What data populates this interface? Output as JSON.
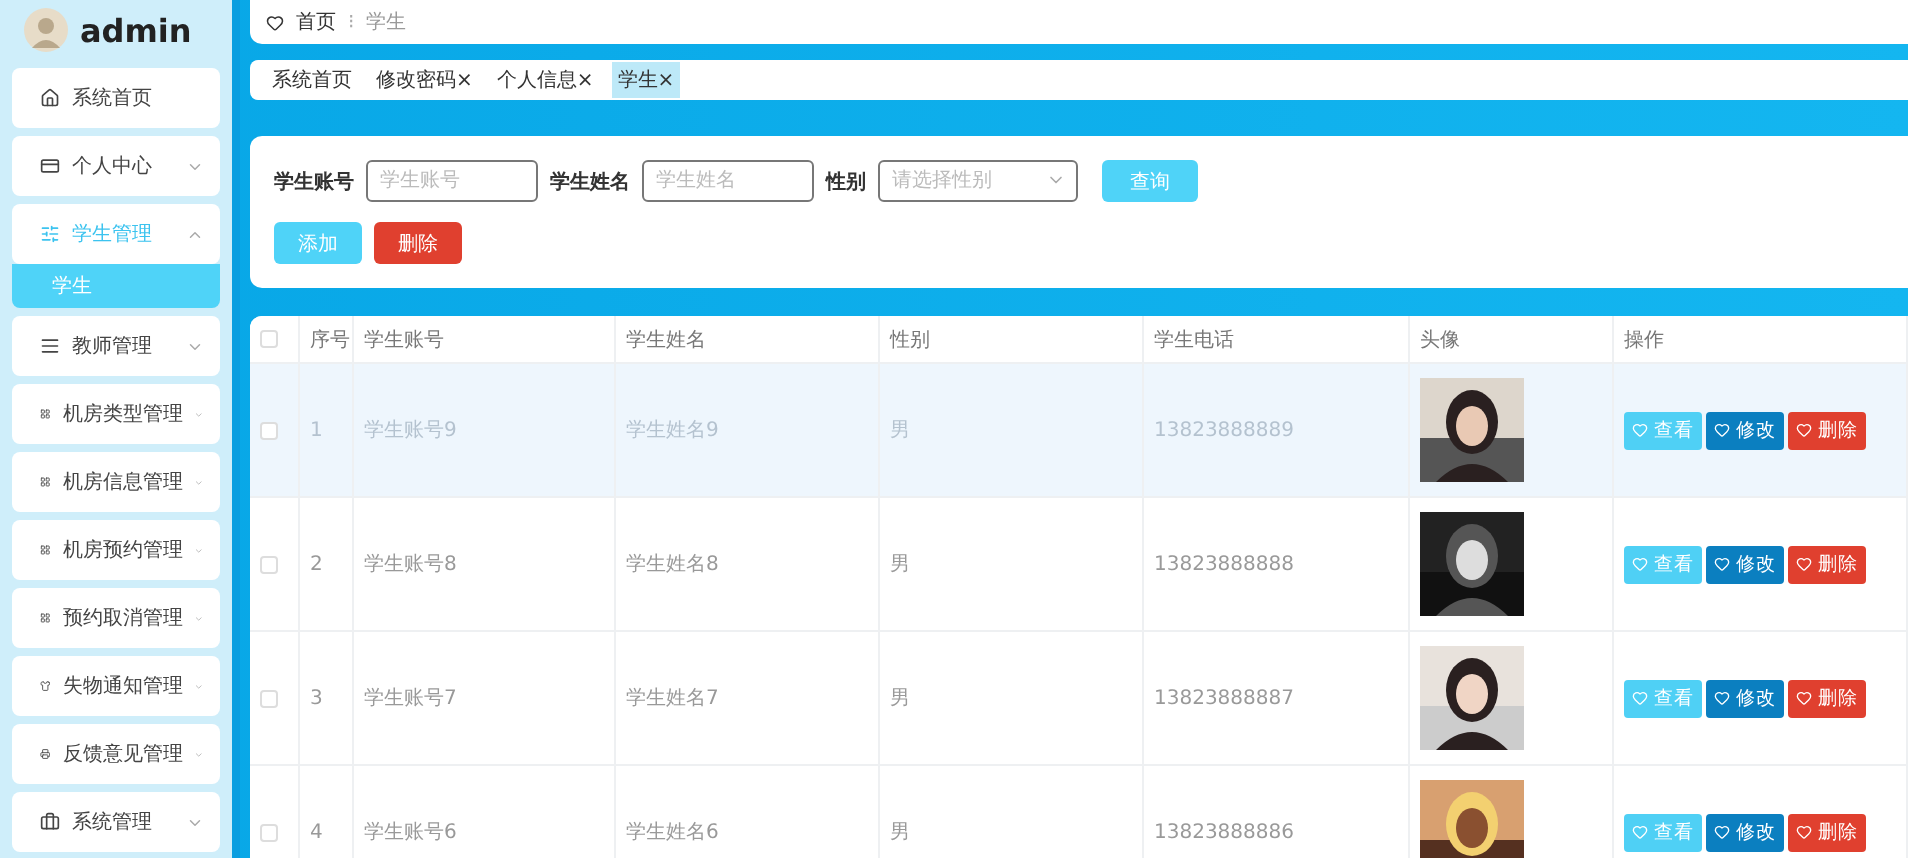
{
  "sidebar": {
    "user": "admin",
    "items": [
      {
        "label": "系统首页",
        "kind": "link"
      },
      {
        "label": "个人中心",
        "kind": "menu",
        "expanded": false
      },
      {
        "label": "学生管理",
        "kind": "menu",
        "expanded": true,
        "children": [
          {
            "label": "学生",
            "selected": true
          }
        ]
      },
      {
        "label": "教师管理",
        "kind": "menu",
        "expanded": false
      },
      {
        "label": "机房类型管理",
        "kind": "menu",
        "expanded": false
      },
      {
        "label": "机房信息管理",
        "kind": "menu",
        "expanded": false
      },
      {
        "label": "机房预约管理",
        "kind": "menu",
        "expanded": false
      },
      {
        "label": "预约取消管理",
        "kind": "menu",
        "expanded": false
      },
      {
        "label": "失物通知管理",
        "kind": "menu",
        "expanded": false
      },
      {
        "label": "反馈意见管理",
        "kind": "menu",
        "expanded": false
      },
      {
        "label": "系统管理",
        "kind": "menu",
        "expanded": false
      }
    ]
  },
  "breadcrumb": [
    "首页",
    "学生"
  ],
  "breadcrumb_separator": "⁝",
  "tabs": [
    {
      "label": "系统首页",
      "closable": false,
      "selected": false
    },
    {
      "label": "修改密码",
      "closable": true,
      "selected": false
    },
    {
      "label": "个人信息",
      "closable": true,
      "selected": false
    },
    {
      "label": "学生",
      "closable": true,
      "selected": true
    }
  ],
  "close_mark": "×",
  "filters": [
    {
      "label": "学生账号",
      "kind": "text",
      "placeholder": "学生账号"
    },
    {
      "label": "学生姓名",
      "kind": "text",
      "placeholder": "学生姓名"
    },
    {
      "label": "性别",
      "kind": "select",
      "placeholder": "请选择性别"
    }
  ],
  "search_button": "查询",
  "add_button": "添加",
  "delete_button": "删除",
  "table": {
    "columns": [
      "序号",
      "学生账号",
      "学生姓名",
      "性别",
      "学生电话",
      "头像",
      "操作"
    ],
    "all_checked": false,
    "rows": [
      {
        "index": "1",
        "account": "学生账号9",
        "name": "学生姓名9",
        "gender": "男",
        "phone": "13823888889",
        "highlighted": true,
        "checked": false,
        "actions": [
          "查看",
          "修改",
          "删除"
        ]
      },
      {
        "index": "2",
        "account": "学生账号8",
        "name": "学生姓名8",
        "gender": "男",
        "phone": "13823888888",
        "highlighted": false,
        "checked": false,
        "actions": [
          "查看",
          "修改",
          "删除"
        ]
      },
      {
        "index": "3",
        "account": "学生账号7",
        "name": "学生姓名7",
        "gender": "男",
        "phone": "13823888887",
        "highlighted": false,
        "checked": false,
        "actions": [
          "查看",
          "修改",
          "删除"
        ]
      },
      {
        "index": "4",
        "account": "学生账号6",
        "name": "学生姓名6",
        "gender": "男",
        "phone": "13823888886",
        "highlighted": false,
        "checked": false,
        "actions": [
          "查看",
          "修改",
          "删除"
        ]
      }
    ]
  }
}
